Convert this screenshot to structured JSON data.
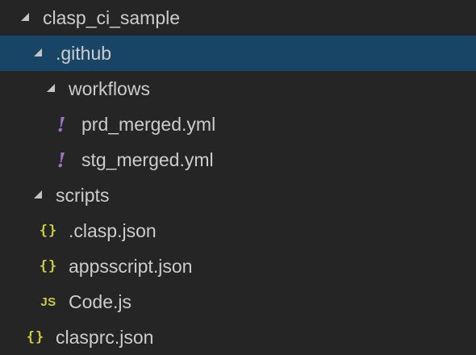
{
  "explorer": {
    "root": {
      "label": "clasp_ci_sample",
      "expanded": true
    },
    "items": [
      {
        "label": ".github",
        "type": "folder",
        "expanded": true,
        "selected": true
      },
      {
        "label": "workflows",
        "type": "folder",
        "expanded": true
      },
      {
        "label": "prd_merged.yml",
        "type": "yaml",
        "icon": "yaml-exclamation-icon"
      },
      {
        "label": "stg_merged.yml",
        "type": "yaml",
        "icon": "yaml-exclamation-icon"
      },
      {
        "label": "scripts",
        "type": "folder",
        "expanded": true
      },
      {
        "label": ".clasp.json",
        "type": "json",
        "icon": "json-braces-icon",
        "glyph": "{}"
      },
      {
        "label": "appsscript.json",
        "type": "json",
        "icon": "json-braces-icon",
        "glyph": "{}"
      },
      {
        "label": "Code.js",
        "type": "js",
        "icon": "javascript-icon",
        "glyph": "JS"
      },
      {
        "label": "clasprc.json",
        "type": "json",
        "icon": "json-braces-icon",
        "glyph": "{}"
      }
    ]
  },
  "colors": {
    "background": "#252526",
    "selected_row": "#184466",
    "text": "#cccccc",
    "json_icon": "#cbcb41",
    "yaml_icon": "#a074c4",
    "twistie": "#c5c5c5"
  }
}
